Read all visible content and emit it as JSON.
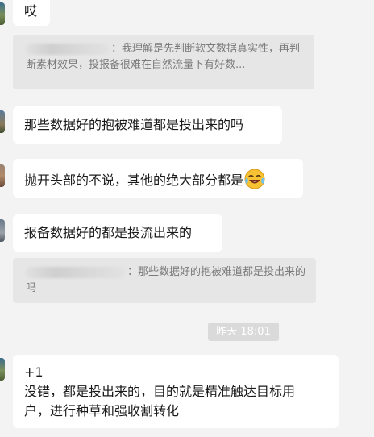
{
  "messages": {
    "m1": {
      "text": "哎"
    },
    "q1": {
      "text": "：我理解是先判断软文数据真实性，再判断素材效果，投报备很难在自然流量下有好数..."
    },
    "m2": {
      "text": "那些数据好的抱被难道都是投出来的吗"
    },
    "m3": {
      "text": "抛开头部的不说，其他的绝大部分都是",
      "emoji": "laughing-with-tears"
    },
    "m4": {
      "text": "报备数据好的都是投流出来的"
    },
    "q2": {
      "text": "：那些数据好的抱被难道都是投出来的吗"
    },
    "timestamp": "昨天 18:01",
    "m5": {
      "line1": "+1",
      "line2": "没错，都是投出来的，目的就是精准触达目标用",
      "line3": "户，进行种草和强收割转化"
    }
  },
  "colors": {
    "background": "#f3f3f3",
    "bubble": "#ffffff",
    "quote": "#e6e6e6",
    "quote_text": "#7a7a7a",
    "time_badge": "#dadada"
  }
}
